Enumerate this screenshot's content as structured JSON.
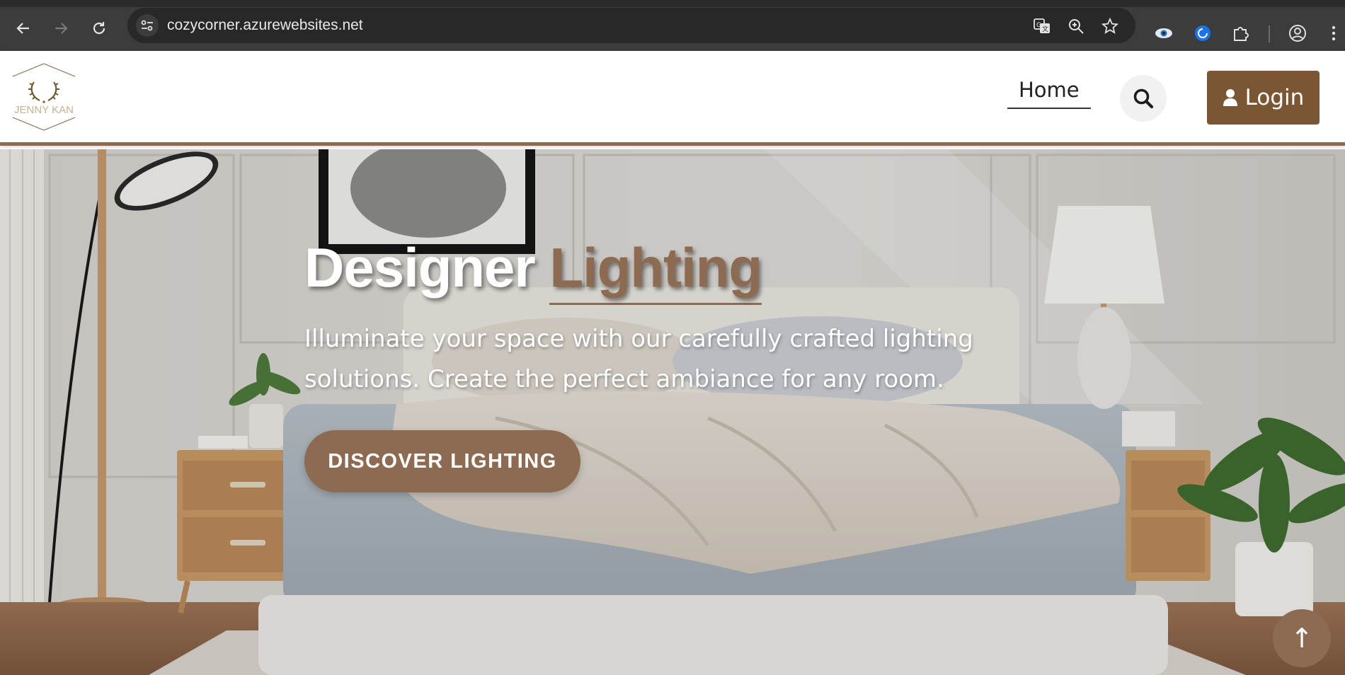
{
  "browser": {
    "url": "cozycorner.azurewebsites.net",
    "icons": [
      "back-icon",
      "forward-icon",
      "reload-icon",
      "site-info-icon",
      "translate-icon",
      "zoom-icon",
      "bookmark-star-icon",
      "eye-extension-icon",
      "blue-extension-icon",
      "extensions-puzzle-icon",
      "profile-icon",
      "menu-kebab-icon"
    ]
  },
  "header": {
    "logo_text": "JENNY KAN",
    "nav_home": "Home",
    "login_label": "Login"
  },
  "hero": {
    "title_main": "Designer",
    "title_accent": "Lighting",
    "subtitle": "Illuminate your space with our carefully crafted lighting solutions. Create the perfect ambiance for any room.",
    "cta_label": "DISCOVER LIGHTING",
    "to_top_label": "↑"
  },
  "colors": {
    "brand_brown": "#8d6a52",
    "login_brown": "#7a5634",
    "chrome_bg": "#3c3c3c",
    "omnibox_bg": "#282828"
  }
}
